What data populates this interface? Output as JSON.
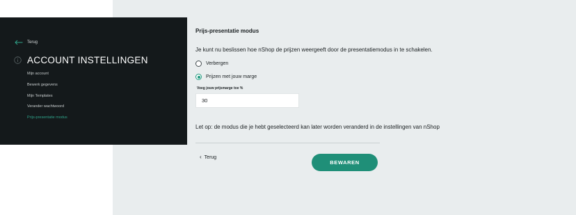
{
  "sidebar": {
    "back_label": "Terug",
    "title": "ACCOUNT INSTELLINGEN",
    "items": [
      {
        "label": "Mijn account"
      },
      {
        "label": "Bewerk gegevens"
      },
      {
        "label": "Mijn Templates"
      },
      {
        "label": "Verander wachtwoord"
      },
      {
        "label": "Prijs-presentatie modus",
        "active": true
      }
    ]
  },
  "main": {
    "section_title": "Prijs-presentatie modus",
    "intro": "Je kunt nu beslissen hoe nShop de prijzen weergeeft door de presentatiemodus in te schakelen.",
    "options": [
      {
        "label": "Verbergen",
        "selected": false
      },
      {
        "label": "Prijzen met jouw marge",
        "selected": true
      }
    ],
    "margin_label": "Voeg jouw prijsmarge toe %",
    "margin_value": "30",
    "note": "Let op: de modus die je hebt geselecteerd kan later worden veranderd in de instellingen van nShop",
    "back_label": "Terug",
    "save_label": "BEWAREN"
  },
  "icons": {
    "back": "arrow-left-icon",
    "info": "info-circle-icon",
    "chevron": "chevron-left-icon"
  },
  "colors": {
    "accent": "#1f8f78",
    "sidebar_bg": "#14191b",
    "content_bg": "#e9edee"
  }
}
